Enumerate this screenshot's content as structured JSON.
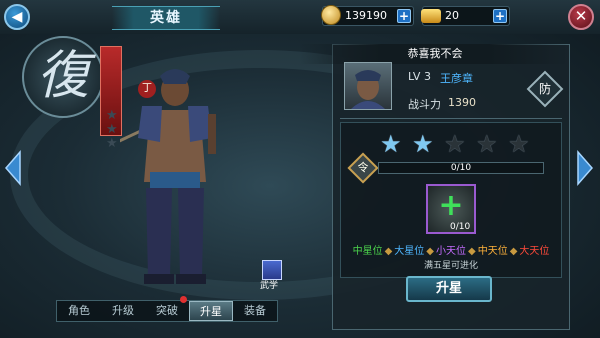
{
  "topbar": {
    "title": "英雄",
    "coins": "139190",
    "ingots": "20",
    "add_symbol": "+"
  },
  "faction": {
    "glyph": "復"
  },
  "hero_card": {
    "display_name": "恭喜我不会",
    "level_label": "LV 3",
    "hero_name": "王彦章",
    "power_label": "战斗力",
    "power_value": "1390",
    "class_glyph": "防"
  },
  "star_upgrade": {
    "stars_total": 5,
    "stars_filled": 2,
    "ling_glyph": "令",
    "progress_text": "0/10",
    "progress_fraction": 0,
    "item_count": "0/10",
    "ranks": [
      {
        "label": "中星位",
        "color": "#4cd44c"
      },
      {
        "label": "大星位",
        "color": "#4fb7ff"
      },
      {
        "label": "小天位",
        "color": "#c56cff"
      },
      {
        "label": "中天位",
        "color": "#ffb23a"
      },
      {
        "label": "大天位",
        "color": "#ff4a3a"
      }
    ],
    "rank_separator": "◆",
    "evolve_hint": "满五星可进化",
    "upgrade_button": "升星"
  },
  "manual_label": "武学",
  "rank_char": "丁",
  "tabs": [
    {
      "label": "角色",
      "active": false
    },
    {
      "label": "升级",
      "active": false
    },
    {
      "label": "突破",
      "active": false
    },
    {
      "label": "升星",
      "active": true
    },
    {
      "label": "装备",
      "active": false
    }
  ],
  "colors": {
    "accent": "#3aa0d8",
    "star_filled": "#7fc8f0",
    "star_empty": "#2a3338"
  }
}
